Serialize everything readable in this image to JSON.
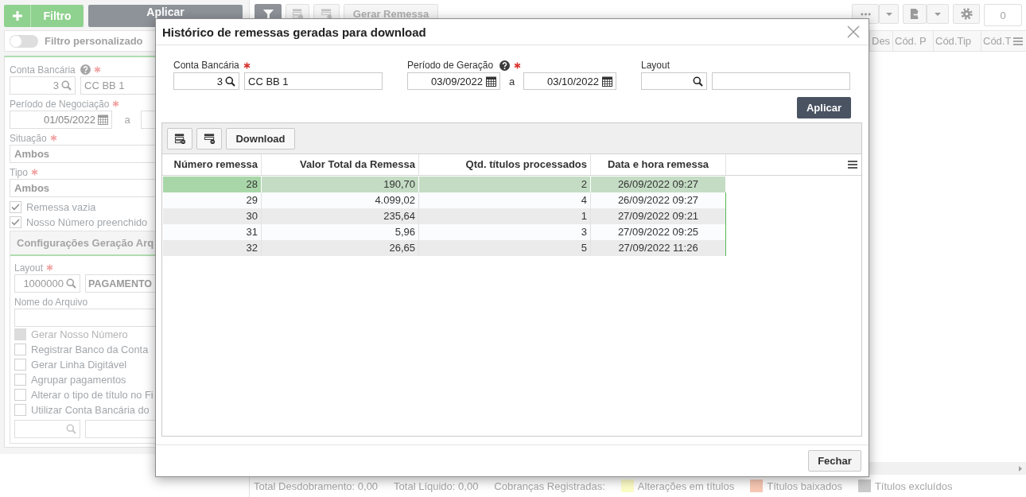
{
  "filter_panel": {
    "add_button": "Filtro",
    "apply_button": "Aplicar",
    "custom_filter": {
      "label": "Filtro personalizado",
      "on": false
    },
    "fields": [
      {
        "kind": "lookup",
        "label": "Conta Bancária",
        "help": true,
        "required": true,
        "code": "3",
        "name": "CC BB 1"
      },
      {
        "kind": "date_range",
        "label": "Período de Negociação",
        "required": true,
        "from": "01/05/2022",
        "separator": "a"
      },
      {
        "kind": "select",
        "label": "Situação",
        "required": true,
        "value": "Ambos"
      },
      {
        "kind": "select",
        "label": "Tipo",
        "required": true,
        "value": "Ambos"
      },
      {
        "kind": "checkbox",
        "label": "Remessa vazia",
        "checked": true,
        "disabled": false
      },
      {
        "kind": "checkbox",
        "label": "Nosso Número preenchido",
        "checked": true,
        "disabled": false
      }
    ],
    "config_section": {
      "title": "Configurações Geração Arq",
      "fields": [
        {
          "kind": "lookup",
          "label": "Layout",
          "required": true,
          "code": "1000000",
          "name": "PAGAMENTO"
        },
        {
          "kind": "text",
          "label": "Nome do Arquivo"
        },
        {
          "kind": "checkbox",
          "label": "Gerar Nosso Número",
          "checked": false,
          "disabled": true
        },
        {
          "kind": "checkbox",
          "label": "Registrar Banco da Conta",
          "checked": false,
          "disabled": false
        },
        {
          "kind": "checkbox",
          "label": "Gerar Linha Digitável",
          "checked": false,
          "disabled": false
        },
        {
          "kind": "checkbox",
          "label": "Agrupar pagamentos",
          "checked": false,
          "disabled": false
        },
        {
          "kind": "checkbox",
          "label": "Alterar o tipo de título no Fi",
          "checked": false,
          "disabled": false
        },
        {
          "kind": "checkbox",
          "label": "Utilizar Conta Bancária do",
          "checked": false,
          "disabled": false
        },
        {
          "kind": "lookup"
        }
      ]
    }
  },
  "toolbar": {
    "generate_button": {
      "label": "Gerar Remessa",
      "disabled": true
    },
    "counter": "0"
  },
  "grid": {
    "columns": [
      "Des",
      "Cód. P",
      "Cód.Tip",
      "Cód.T"
    ]
  },
  "status_bar": {
    "totals": [
      "Total Desdobramento: 0,00",
      "Total Líquido: 0,00"
    ],
    "legend_title": "Cobranças Registradas:",
    "legend": [
      {
        "label": "Alterações em títulos",
        "color": "#fdfdc8"
      },
      {
        "label": "Títulos baixados",
        "color": "#f8c8b4"
      },
      {
        "label": "Títulos excluídos",
        "color": "#cbcbcb"
      }
    ]
  },
  "dialog": {
    "title": "Histórico de remessas geradas para download",
    "filters": [
      {
        "kind": "lookup",
        "label": "Conta Bancária",
        "required": true,
        "code": "3",
        "name": "CC BB 1"
      },
      {
        "kind": "date_range",
        "label": "Período de Geração",
        "help": true,
        "required": true,
        "from": "03/09/2022",
        "separator": "a",
        "to": "03/10/2022"
      },
      {
        "kind": "lookup",
        "label": "Layout"
      }
    ],
    "apply_button": "Aplicar",
    "download_button": "Download",
    "table": {
      "columns": [
        "Número remessa",
        "Valor Total da Remessa",
        "Qtd. títulos processados",
        "Data e hora remessa"
      ],
      "rows": [
        {
          "selected": true,
          "cells": [
            "28",
            "190,70",
            "2",
            "26/09/2022 09:27"
          ]
        },
        {
          "selected": false,
          "cells": [
            "29",
            "4.099,02",
            "4",
            "26/09/2022 09:27"
          ]
        },
        {
          "selected": false,
          "cells": [
            "30",
            "235,64",
            "1",
            "27/09/2022 09:21"
          ]
        },
        {
          "selected": false,
          "cells": [
            "31",
            "5,96",
            "3",
            "27/09/2022 09:25"
          ]
        },
        {
          "selected": false,
          "cells": [
            "32",
            "26,65",
            "5",
            "27/09/2022 11:26"
          ]
        }
      ]
    },
    "close_button": "Fechar"
  }
}
